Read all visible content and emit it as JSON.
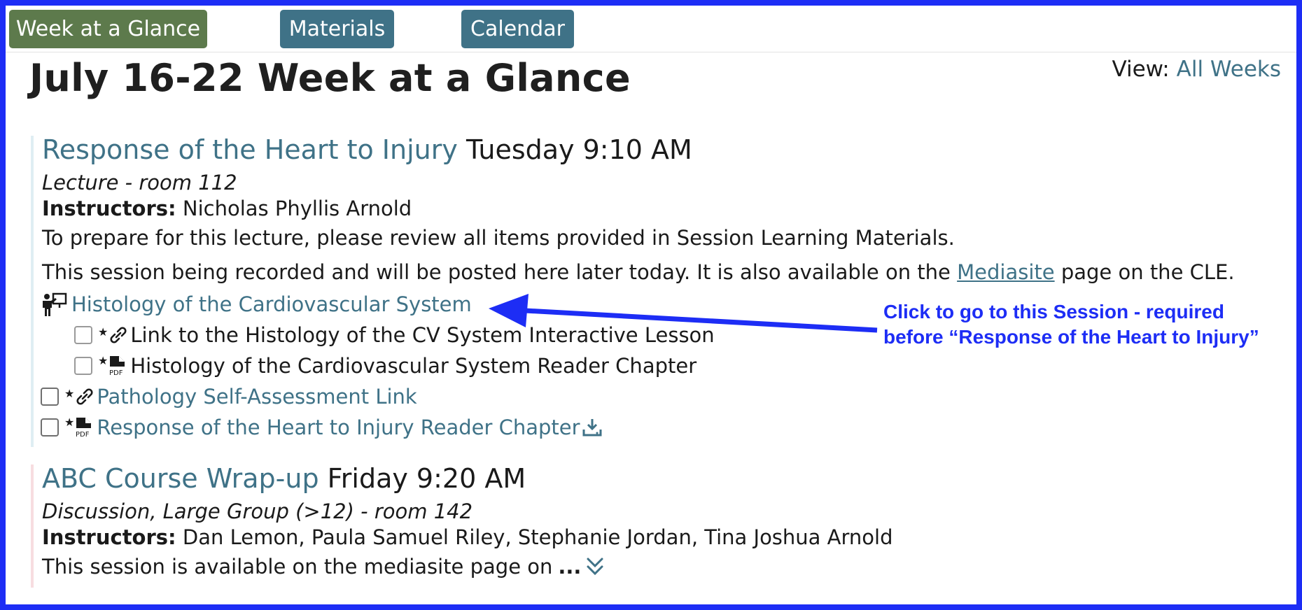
{
  "tabs": [
    {
      "label": "Week at a Glance",
      "active": true
    },
    {
      "label": "Materials",
      "active": false
    },
    {
      "label": "Calendar",
      "active": false
    }
  ],
  "page_title": "July 16-22 Week at a Glance",
  "view": {
    "label": "View:",
    "link": "All Weeks"
  },
  "sessions": [
    {
      "title": "Response of the Heart to Injury",
      "time": "Tuesday 9:10 AM",
      "type_room": "Lecture - room 112",
      "instructors_label": "Instructors:",
      "instructors": "Nicholas Phyllis Arnold",
      "prep_text": "To prepare for this lecture, please review all items provided in Session Learning Materials.",
      "recording_pre": "This session being recorded and will be posted here later today. It is also available on the",
      "recording_link": "Mediasite",
      "recording_post": "page on the CLE.",
      "prereq": {
        "title": "Histology of the Cardiovascular System",
        "icon": "presenter-icon",
        "items": [
          {
            "label": "Link to the Histology of the CV System Interactive Lesson",
            "icon": "link-icon"
          },
          {
            "label": "Histology of the Cardiovascular System Reader Chapter",
            "icon": "pdf-icon"
          }
        ]
      },
      "materials": [
        {
          "label": "Pathology Self-Assessment Link",
          "icon": "link-icon"
        },
        {
          "label": "Response of the Heart to Injury Reader Chapter",
          "icon": "pdf-icon",
          "download": "download-icon"
        }
      ]
    },
    {
      "title": "ABC Course Wrap-up",
      "time": "Friday 9:20 AM",
      "type_room": "Discussion, Large Group (>12) - room 142",
      "instructors_label": "Instructors:",
      "instructors": "Dan Lemon, Paula Samuel Riley, Stephanie Jordan, Tina Joshua Arnold",
      "description": "This session is available on the mediasite page on",
      "ellipsis": "...",
      "expand_icon": "double-chevron-down-icon"
    }
  ],
  "annotation": "Click to go to this Session - required before “Response of the Heart to Injury”",
  "colors": {
    "frame": "#1d2df5",
    "tab_active": "#5d7a4c",
    "tab": "#3f7287",
    "link": "#3f7287"
  }
}
